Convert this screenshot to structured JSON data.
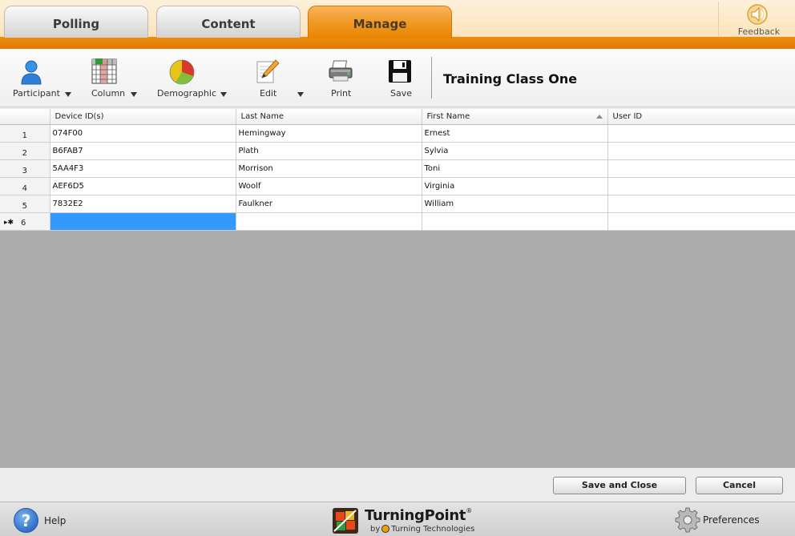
{
  "tabs": {
    "polling": "Polling",
    "content": "Content",
    "manage": "Manage"
  },
  "feedback": {
    "label": "Feedback"
  },
  "toolbar": {
    "participant": "Participant",
    "column": "Column",
    "demographic": "Demographic",
    "edit": "Edit",
    "print": "Print",
    "save": "Save",
    "class_title": "Training Class One"
  },
  "grid": {
    "columns": [
      "Device ID(s)",
      "Last Name",
      "First Name",
      "User ID"
    ],
    "rows": [
      {
        "num": "1",
        "device": "074F00",
        "last": "Hemingway",
        "first": "Ernest",
        "userid": ""
      },
      {
        "num": "2",
        "device": "B6FAB7",
        "last": "Plath",
        "first": "Sylvia",
        "userid": ""
      },
      {
        "num": "3",
        "device": "5AA4F3",
        "last": "Morrison",
        "first": "Toni",
        "userid": ""
      },
      {
        "num": "4",
        "device": "AEF6D5",
        "last": "Woolf",
        "first": "Virginia",
        "userid": ""
      },
      {
        "num": "5",
        "device": "7832E2",
        "last": "Faulkner",
        "first": "William",
        "userid": ""
      }
    ],
    "new_row": {
      "marker": "▸✱",
      "num": "6"
    }
  },
  "actions": {
    "save_close": "Save and Close",
    "cancel": "Cancel"
  },
  "footer": {
    "help": "Help",
    "brand_name": "TurningPoint",
    "brand_reg": "®",
    "brand_by": "by",
    "brand_company": "Turning Technologies",
    "preferences": "Preferences"
  },
  "colors": {
    "accent": "#e88400",
    "selection": "#3399ff",
    "grid_bg": "#ababab"
  }
}
